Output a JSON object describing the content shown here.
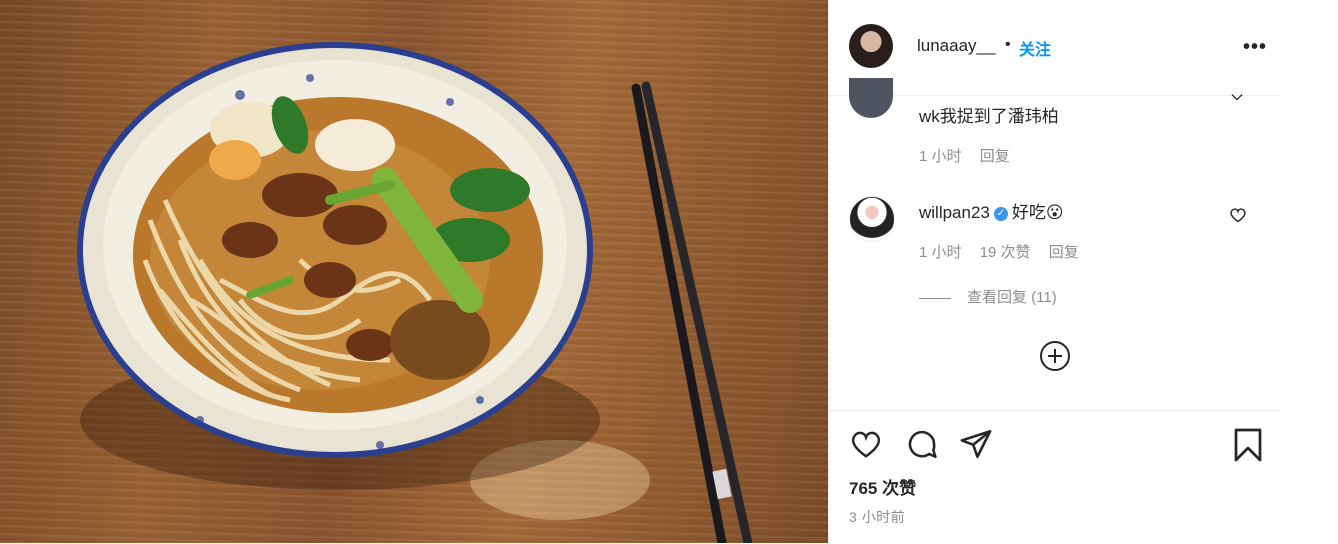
{
  "post": {
    "username": "lunaaay__",
    "separator": "•",
    "follow_label": "关注",
    "more_label": "•••"
  },
  "comments": [
    {
      "text": "wk我捉到了潘玮柏",
      "time": "1 小时",
      "reply_label": "回复"
    },
    {
      "username": "willpan23",
      "text": "好吃😮",
      "time": "1 小时",
      "likes": "19 次赞",
      "reply_label": "回复",
      "view_replies": "查看回复 (11)"
    }
  ],
  "footer": {
    "likes": "765 次赞",
    "timestamp": "3 小时前"
  },
  "icons": {
    "like": "heart-icon",
    "comment": "comment-icon",
    "share": "share-icon",
    "save": "bookmark-icon",
    "load_more": "plus-circle-icon"
  },
  "colors": {
    "accent": "#0095f6",
    "verified": "#3897f0",
    "muted": "#8e8e8e"
  }
}
